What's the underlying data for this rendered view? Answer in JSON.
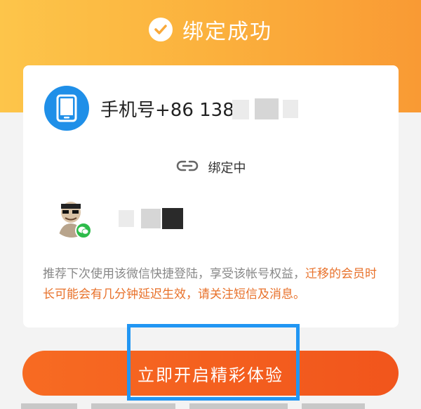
{
  "header": {
    "title": "绑定成功",
    "icon": "check-circle-icon",
    "gradient": [
      "#fdc54a",
      "#f99a34"
    ]
  },
  "phone_account": {
    "icon": "smartphone-icon",
    "label": "手机号+86 138",
    "icon_color": "#1f8fe8"
  },
  "link_status": {
    "icon": "link-icon",
    "text": "绑定中"
  },
  "wechat_account": {
    "avatar": "avatar-image",
    "badge_icon": "wechat-icon",
    "badge_color": "#2dbb4a"
  },
  "notice": {
    "normal_text": "推荐下次使用该微信快捷登陆，享受该帐号权益，",
    "highlight_text": "迁移的会员时长可能会有几分钟延迟生效，请关注短信及消息。",
    "highlight_color": "#e8712a"
  },
  "cta": {
    "label": "立即开启精彩体验",
    "color": "#f1551c"
  },
  "annotation": {
    "color": "#2196f3"
  }
}
